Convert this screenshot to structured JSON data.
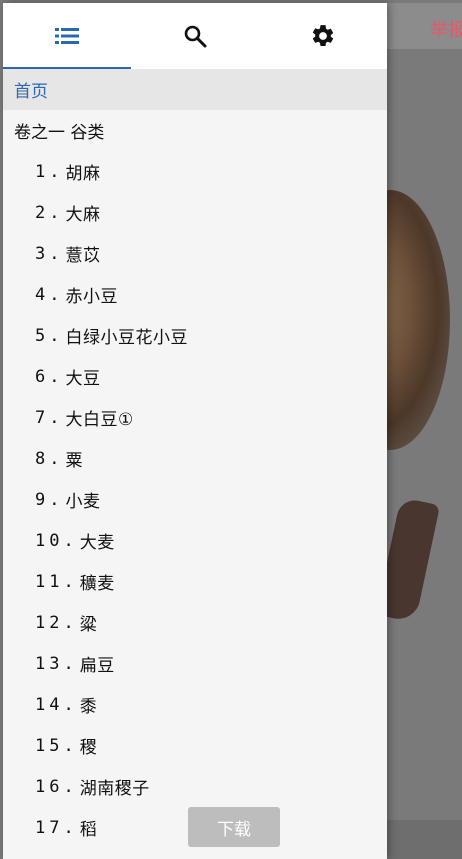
{
  "background_app": {
    "topbar_text": "举报"
  },
  "drawer": {
    "tabs": [
      {
        "icon": "list-icon",
        "active": true
      },
      {
        "icon": "search-icon",
        "active": false
      },
      {
        "icon": "gear-icon",
        "active": false
      }
    ],
    "home_label": "首页",
    "section_label": "卷之一 谷类",
    "items": [
      {
        "num": "1.",
        "label": "胡麻"
      },
      {
        "num": "2.",
        "label": "大麻"
      },
      {
        "num": "3.",
        "label": "薏苡"
      },
      {
        "num": "4.",
        "label": "赤小豆"
      },
      {
        "num": "5.",
        "label": "白绿小豆花小豆"
      },
      {
        "num": "6.",
        "label": "大豆"
      },
      {
        "num": "7.",
        "label": "大白豆①"
      },
      {
        "num": "8.",
        "label": "粟"
      },
      {
        "num": "9.",
        "label": "小麦"
      },
      {
        "num": "10.",
        "label": "大麦"
      },
      {
        "num": "11.",
        "label": "穬麦"
      },
      {
        "num": "12.",
        "label": "粱"
      },
      {
        "num": "13.",
        "label": "扁豆"
      },
      {
        "num": "14.",
        "label": "黍"
      },
      {
        "num": "15.",
        "label": "稷"
      },
      {
        "num": "16.",
        "label": "湖南稷子"
      },
      {
        "num": "17.",
        "label": "稻"
      }
    ],
    "download_label": "下载"
  },
  "colors": {
    "accent": "#2b68b0",
    "drawer_bg": "#f5f5f5",
    "home_bg": "#e6e6e6",
    "button_bg": "#bdbdbd"
  }
}
